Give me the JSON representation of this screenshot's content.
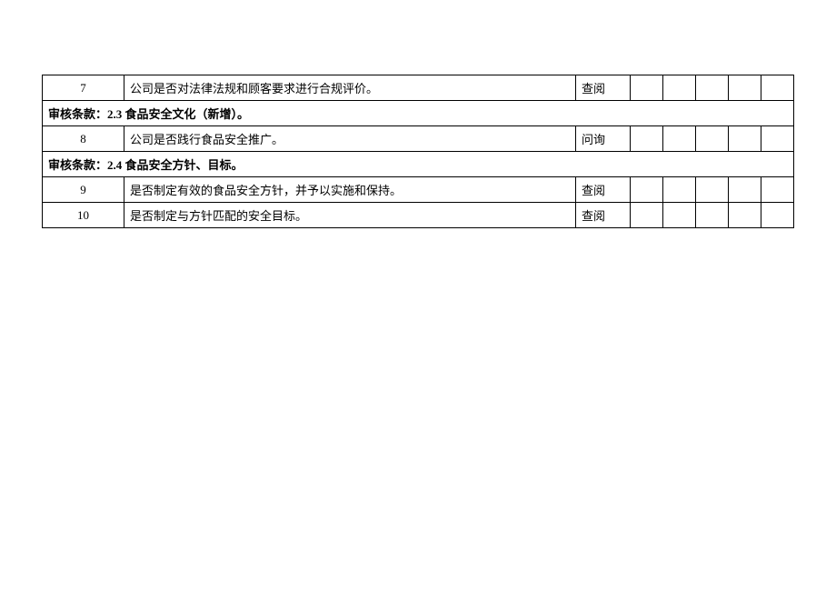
{
  "rows": [
    {
      "type": "item",
      "num": "7",
      "desc": "公司是否对法律法规和顾客要求进行合规评价。",
      "method": "查阅"
    },
    {
      "type": "section",
      "label": "审核条款：2.3 食品安全文化（新增）。"
    },
    {
      "type": "item",
      "num": "8",
      "desc": "公司是否践行食品安全推广。",
      "method": "问询"
    },
    {
      "type": "section",
      "label": "审核条款：2.4 食品安全方针、目标。"
    },
    {
      "type": "item",
      "num": "9",
      "desc": "是否制定有效的食品安全方针，并予以实施和保持。",
      "method": "查阅"
    },
    {
      "type": "item",
      "num": "10",
      "desc": "是否制定与方针匹配的安全目标。",
      "method": "查阅"
    }
  ]
}
